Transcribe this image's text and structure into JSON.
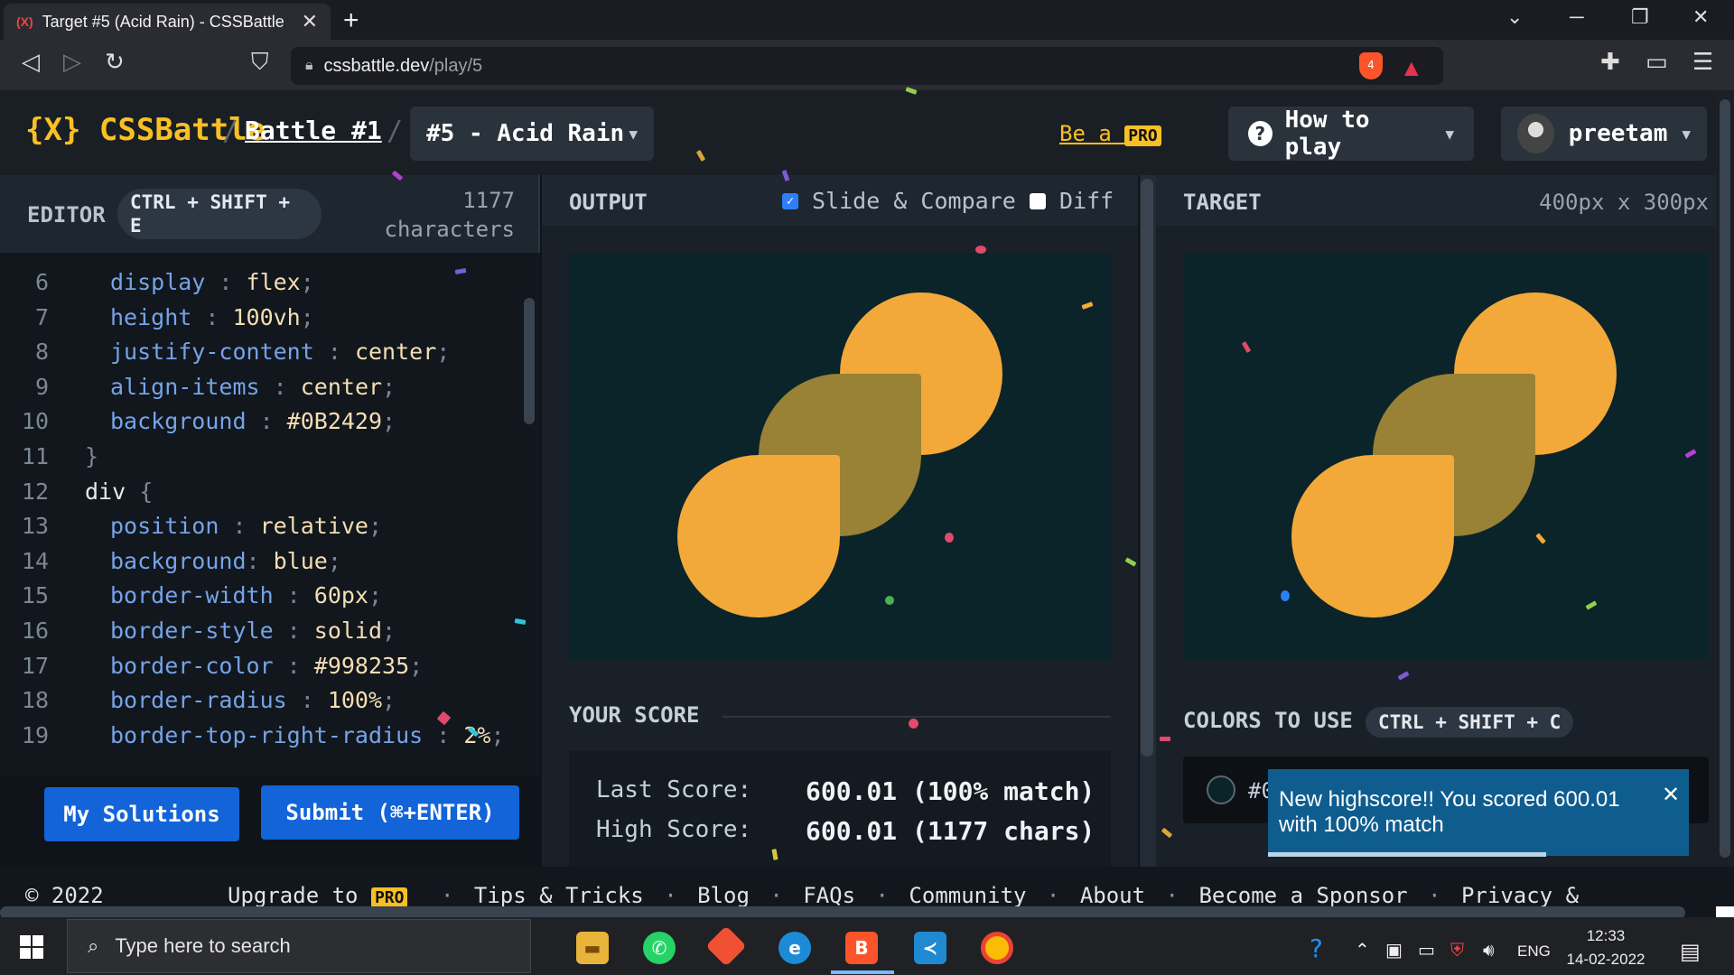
{
  "browser": {
    "tab_title": "Target #5 (Acid Rain) - CSSBattle",
    "tab_favicon": "(X)",
    "url_host": "cssbattle.dev",
    "url_path": "/play/5",
    "shield_count": "4"
  },
  "header": {
    "logo_mark": "{X}",
    "logo_text": "CSSBattle",
    "sep": "/",
    "battle_link": "Battle #1",
    "target_select": "#5 - Acid Rain",
    "be_a": "Be a",
    "pro_badge": "PRO",
    "how_to_play": "How to play",
    "username": "preetam"
  },
  "editor": {
    "label": "EDITOR",
    "shortcut": "CTRL + SHIFT + E",
    "char_count": "1177",
    "char_unit": "characters",
    "lines": [
      {
        "n": "6",
        "prop": "display",
        "sep": " : ",
        "val": "flex",
        "end": ";"
      },
      {
        "n": "7",
        "prop": "height",
        "sep": " : ",
        "val": "100vh",
        "end": ";"
      },
      {
        "n": "8",
        "prop": "justify-content",
        "sep": " : ",
        "val": "center",
        "end": ";"
      },
      {
        "n": "9",
        "prop": "align-items",
        "sep": " : ",
        "val": "center",
        "end": ";"
      },
      {
        "n": "10",
        "prop": "background",
        "sep": " : ",
        "val": "#0B2429",
        "end": ";"
      },
      {
        "n": "11",
        "brace": "}"
      },
      {
        "n": "12",
        "sel": "div",
        "brace": " {"
      },
      {
        "n": "13",
        "prop": "position",
        "sep": " : ",
        "val": "relative",
        "end": ";"
      },
      {
        "n": "14",
        "prop": "background",
        "sep": ": ",
        "val": "blue",
        "end": ";"
      },
      {
        "n": "15",
        "prop": "border-width",
        "sep": " : ",
        "val": "60px",
        "end": ";"
      },
      {
        "n": "16",
        "prop": "border-style",
        "sep": " : ",
        "val": "solid",
        "end": ";"
      },
      {
        "n": "17",
        "prop": "border-color",
        "sep": " : ",
        "val": "#998235",
        "end": ";"
      },
      {
        "n": "18",
        "prop": "border-radius",
        "sep": " : ",
        "val": "100%",
        "end": ";"
      },
      {
        "n": "19",
        "prop": "border-top-right-radius",
        "sep": " : ",
        "val": "2%",
        "end": ";"
      }
    ],
    "my_solutions": "My Solutions",
    "submit": "Submit (⌘+ENTER)"
  },
  "output": {
    "label": "OUTPUT",
    "slide_compare": "Slide & Compare",
    "slide_checked": true,
    "diff": "Diff",
    "diff_checked": false,
    "score_heading": "YOUR SCORE",
    "last_label": "Last Score:",
    "last_value": "600.01 (100% match)",
    "high_label": "High Score:",
    "high_value": "600.01 (1177 chars)"
  },
  "target": {
    "label": "TARGET",
    "size": "400px x 300px",
    "colors_heading": "COLORS TO USE",
    "colors_shortcut": "CTRL + SHIFT + C",
    "color_partial": "#0",
    "colors": {
      "bg": "#0B2429",
      "orange": "#F3A93A",
      "olive": "#998235"
    }
  },
  "toast": {
    "message": "New highscore!! You scored 600.01 with 100% match",
    "progress": 0.66
  },
  "footer": {
    "copyright": "© 2022",
    "upgrade": "Upgrade to",
    "pro": "PRO",
    "links": [
      "Tips & Tricks",
      "Blog",
      "FAQs",
      "Community",
      "About",
      "Become a Sponsor",
      "Privacy &"
    ]
  },
  "taskbar": {
    "search_placeholder": "Type here to search",
    "lang": "ENG",
    "time": "12:33",
    "date": "14-02-2022",
    "apps": [
      "file-explorer-icon",
      "whatsapp-icon",
      "git-icon",
      "edge-icon",
      "brave-icon",
      "vscode-icon",
      "chrome-icon"
    ]
  }
}
